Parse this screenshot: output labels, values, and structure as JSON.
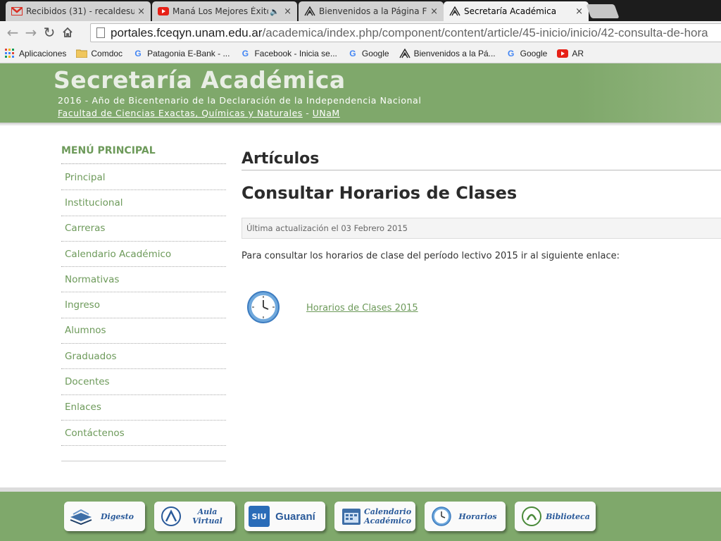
{
  "browser": {
    "tabs": [
      {
        "title": "Recibidos (31) - recaldesu",
        "icon": "gmail-icon",
        "close": "×"
      },
      {
        "title": "Maná Los Mejores Éxito",
        "icon": "youtube-icon",
        "audio": "🔈",
        "close": "×"
      },
      {
        "title": "Bienvenidos a la Página FC",
        "icon": "site-logo-icon",
        "close": "×"
      },
      {
        "title": "Secretaría Académica",
        "icon": "site-logo-icon",
        "close": "×"
      }
    ],
    "url_host": "portales.fceqyn.unam.edu.ar",
    "url_path": "/academica/index.php/component/content/article/45-inicio/inicio/42-consulta-de-hora",
    "bookmarks": [
      {
        "label": "Aplicaciones",
        "icon": "apps-grid-icon"
      },
      {
        "label": "Comdoc",
        "icon": "folder-icon"
      },
      {
        "label": "Patagonia E-Bank - ...",
        "icon": "google-icon"
      },
      {
        "label": "Facebook - Inicia se...",
        "icon": "google-icon"
      },
      {
        "label": "Google",
        "icon": "google-icon"
      },
      {
        "label": "Bienvenidos a la Pá...",
        "icon": "site-logo-icon"
      },
      {
        "label": "Google",
        "icon": "google-icon"
      },
      {
        "label": "AR",
        "icon": "youtube-icon"
      }
    ]
  },
  "header": {
    "title": "Secretaría Académica",
    "subtitle": "2016 - Año de Bicentenario de la Declaración de la Independencia Nacional",
    "faculty_link": "Facultad de Ciencias Exactas, Químicas y Naturales",
    "separator": " - ",
    "unam_link": "UNaM"
  },
  "sidebar": {
    "title": "MENÚ PRINCIPAL",
    "items": [
      {
        "label": "Principal"
      },
      {
        "label": "Institucional"
      },
      {
        "label": "Carreras"
      },
      {
        "label": "Calendario Académico"
      },
      {
        "label": "Normativas"
      },
      {
        "label": "Ingreso"
      },
      {
        "label": "Alumnos"
      },
      {
        "label": "Graduados"
      },
      {
        "label": "Docentes"
      },
      {
        "label": "Enlaces"
      },
      {
        "label": "Contáctenos"
      }
    ]
  },
  "main": {
    "section_title": "Artículos",
    "article_title": "Consultar Horarios de Clases",
    "updated": "Última actualización el 03 Febrero 2015",
    "body": "Para consultar los horarios de clase del período lectivo 2015 ir al siguiente enlace:",
    "link_label": "Horarios de Clases 2015"
  },
  "footer": {
    "buttons": [
      {
        "label": "Digesto",
        "icon": "books-icon"
      },
      {
        "label": "Aula Virtual",
        "icon": "aula-virtual-icon"
      },
      {
        "label": "Guaraní",
        "icon": "siu-guarani-logo"
      },
      {
        "label": "Calendario Académico",
        "icon": "calendar-icon"
      },
      {
        "label": "Horarios",
        "icon": "clock-icon"
      },
      {
        "label": "Biblioteca",
        "icon": "library-icon"
      }
    ]
  },
  "colors": {
    "header_green": "#7fa86b",
    "link_green": "#6d9a5a",
    "text_dark": "#2b2b2b"
  }
}
